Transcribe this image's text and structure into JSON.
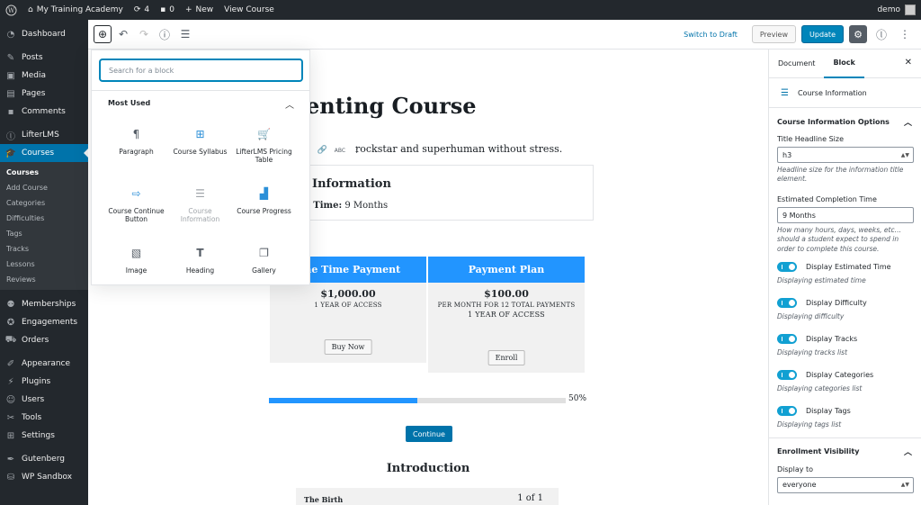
{
  "admin_bar": {
    "site_name": "My Training Academy",
    "updates_count": "4",
    "comments_count": "0",
    "new_label": "New",
    "view_label": "View Course",
    "user": "demo"
  },
  "sidebar": {
    "items": [
      {
        "label": "Dashboard",
        "icon": "dashboard-icon"
      },
      {
        "label": "Posts",
        "icon": "pin-icon"
      },
      {
        "label": "Media",
        "icon": "media-icon"
      },
      {
        "label": "Pages",
        "icon": "page-icon"
      },
      {
        "label": "Comments",
        "icon": "comment-icon"
      },
      {
        "label": "LifterLMS",
        "icon": "lifter-icon"
      },
      {
        "label": "Courses",
        "icon": "graduation-cap-icon"
      }
    ],
    "submenu": [
      "Courses",
      "Add Course",
      "Categories",
      "Difficulties",
      "Tags",
      "Tracks",
      "Lessons",
      "Reviews"
    ],
    "items2": [
      {
        "label": "Memberships",
        "icon": "group-icon"
      },
      {
        "label": "Engagements",
        "icon": "award-icon"
      },
      {
        "label": "Orders",
        "icon": "cart-icon"
      },
      {
        "label": "Appearance",
        "icon": "brush-icon"
      },
      {
        "label": "Plugins",
        "icon": "plugin-icon"
      },
      {
        "label": "Users",
        "icon": "user-icon"
      },
      {
        "label": "Tools",
        "icon": "wrench-icon"
      },
      {
        "label": "Settings",
        "icon": "settings-icon"
      },
      {
        "label": "Gutenberg",
        "icon": "pen-icon"
      },
      {
        "label": "WP Sandbox",
        "icon": "sandbox-icon"
      }
    ]
  },
  "header": {
    "switch_draft": "Switch to Draft",
    "preview": "Preview",
    "update": "Update"
  },
  "canvas": {
    "title": "enting Course",
    "paragraph": "rockstar and superhuman without stress.",
    "info_title": "Information",
    "info_line_label": "l Time:",
    "info_line_value": "9 Months",
    "pricing": [
      {
        "title": "One Time Payment",
        "price": "$1,000.00",
        "sub1": "1 YEAR OF ACCESS",
        "sub2": "",
        "button": "Buy Now"
      },
      {
        "title": "Payment Plan",
        "price": "$100.00",
        "sub1": "PER MONTH FOR 12 TOTAL PAYMENTS",
        "sub2": "1 YEAR OF ACCESS",
        "button": "Enroll"
      }
    ],
    "progress": 50,
    "progress_label": "50%",
    "continue": "Continue",
    "section": "Introduction",
    "lesson_title": "The Birth",
    "lesson_count": "1 of 1"
  },
  "inserter": {
    "search_placeholder": "Search for a block",
    "panel_title": "Most Used",
    "blocks": [
      {
        "label": "Paragraph",
        "icon": "paragraph-icon"
      },
      {
        "label": "Course Syllabus",
        "icon": "syllabus-icon"
      },
      {
        "label": "LifterLMS Pricing Table",
        "icon": "pricing-table-icon"
      },
      {
        "label": "Course Continue Button",
        "icon": "continue-button-icon"
      },
      {
        "label": "Course Information",
        "icon": "course-information-icon"
      },
      {
        "label": "Course Progress",
        "icon": "progress-icon"
      },
      {
        "label": "Image",
        "icon": "image-icon"
      },
      {
        "label": "Heading",
        "icon": "heading-icon"
      },
      {
        "label": "Gallery",
        "icon": "gallery-icon"
      }
    ]
  },
  "right_panel": {
    "tabs": [
      "Document",
      "Block"
    ],
    "block_name": "Course Information",
    "section_title": "Course Information Options",
    "headline_label": "Title Headline Size",
    "headline_value": "h3",
    "headline_help": "Headline size for the information title element.",
    "time_label": "Estimated Completion Time",
    "time_value": "9 Months",
    "time_help": "How many hours, days, weeks, etc… should a student expect to spend in order to complete this course.",
    "toggles": [
      {
        "label": "Display Estimated Time",
        "help": "Displaying estimated time"
      },
      {
        "label": "Display Difficulty",
        "help": "Displaying difficulty"
      },
      {
        "label": "Display Tracks",
        "help": "Displaying tracks list"
      },
      {
        "label": "Display Categories",
        "help": "Displaying categories list"
      },
      {
        "label": "Display Tags",
        "help": "Displaying tags list"
      }
    ],
    "enroll_title": "Enrollment Visibility",
    "display_to_label": "Display to",
    "display_to_value": "everyone"
  },
  "colors": {
    "accent": "#0085ba",
    "pricing_header": "#2295ff",
    "admin_bg": "#23282d"
  }
}
